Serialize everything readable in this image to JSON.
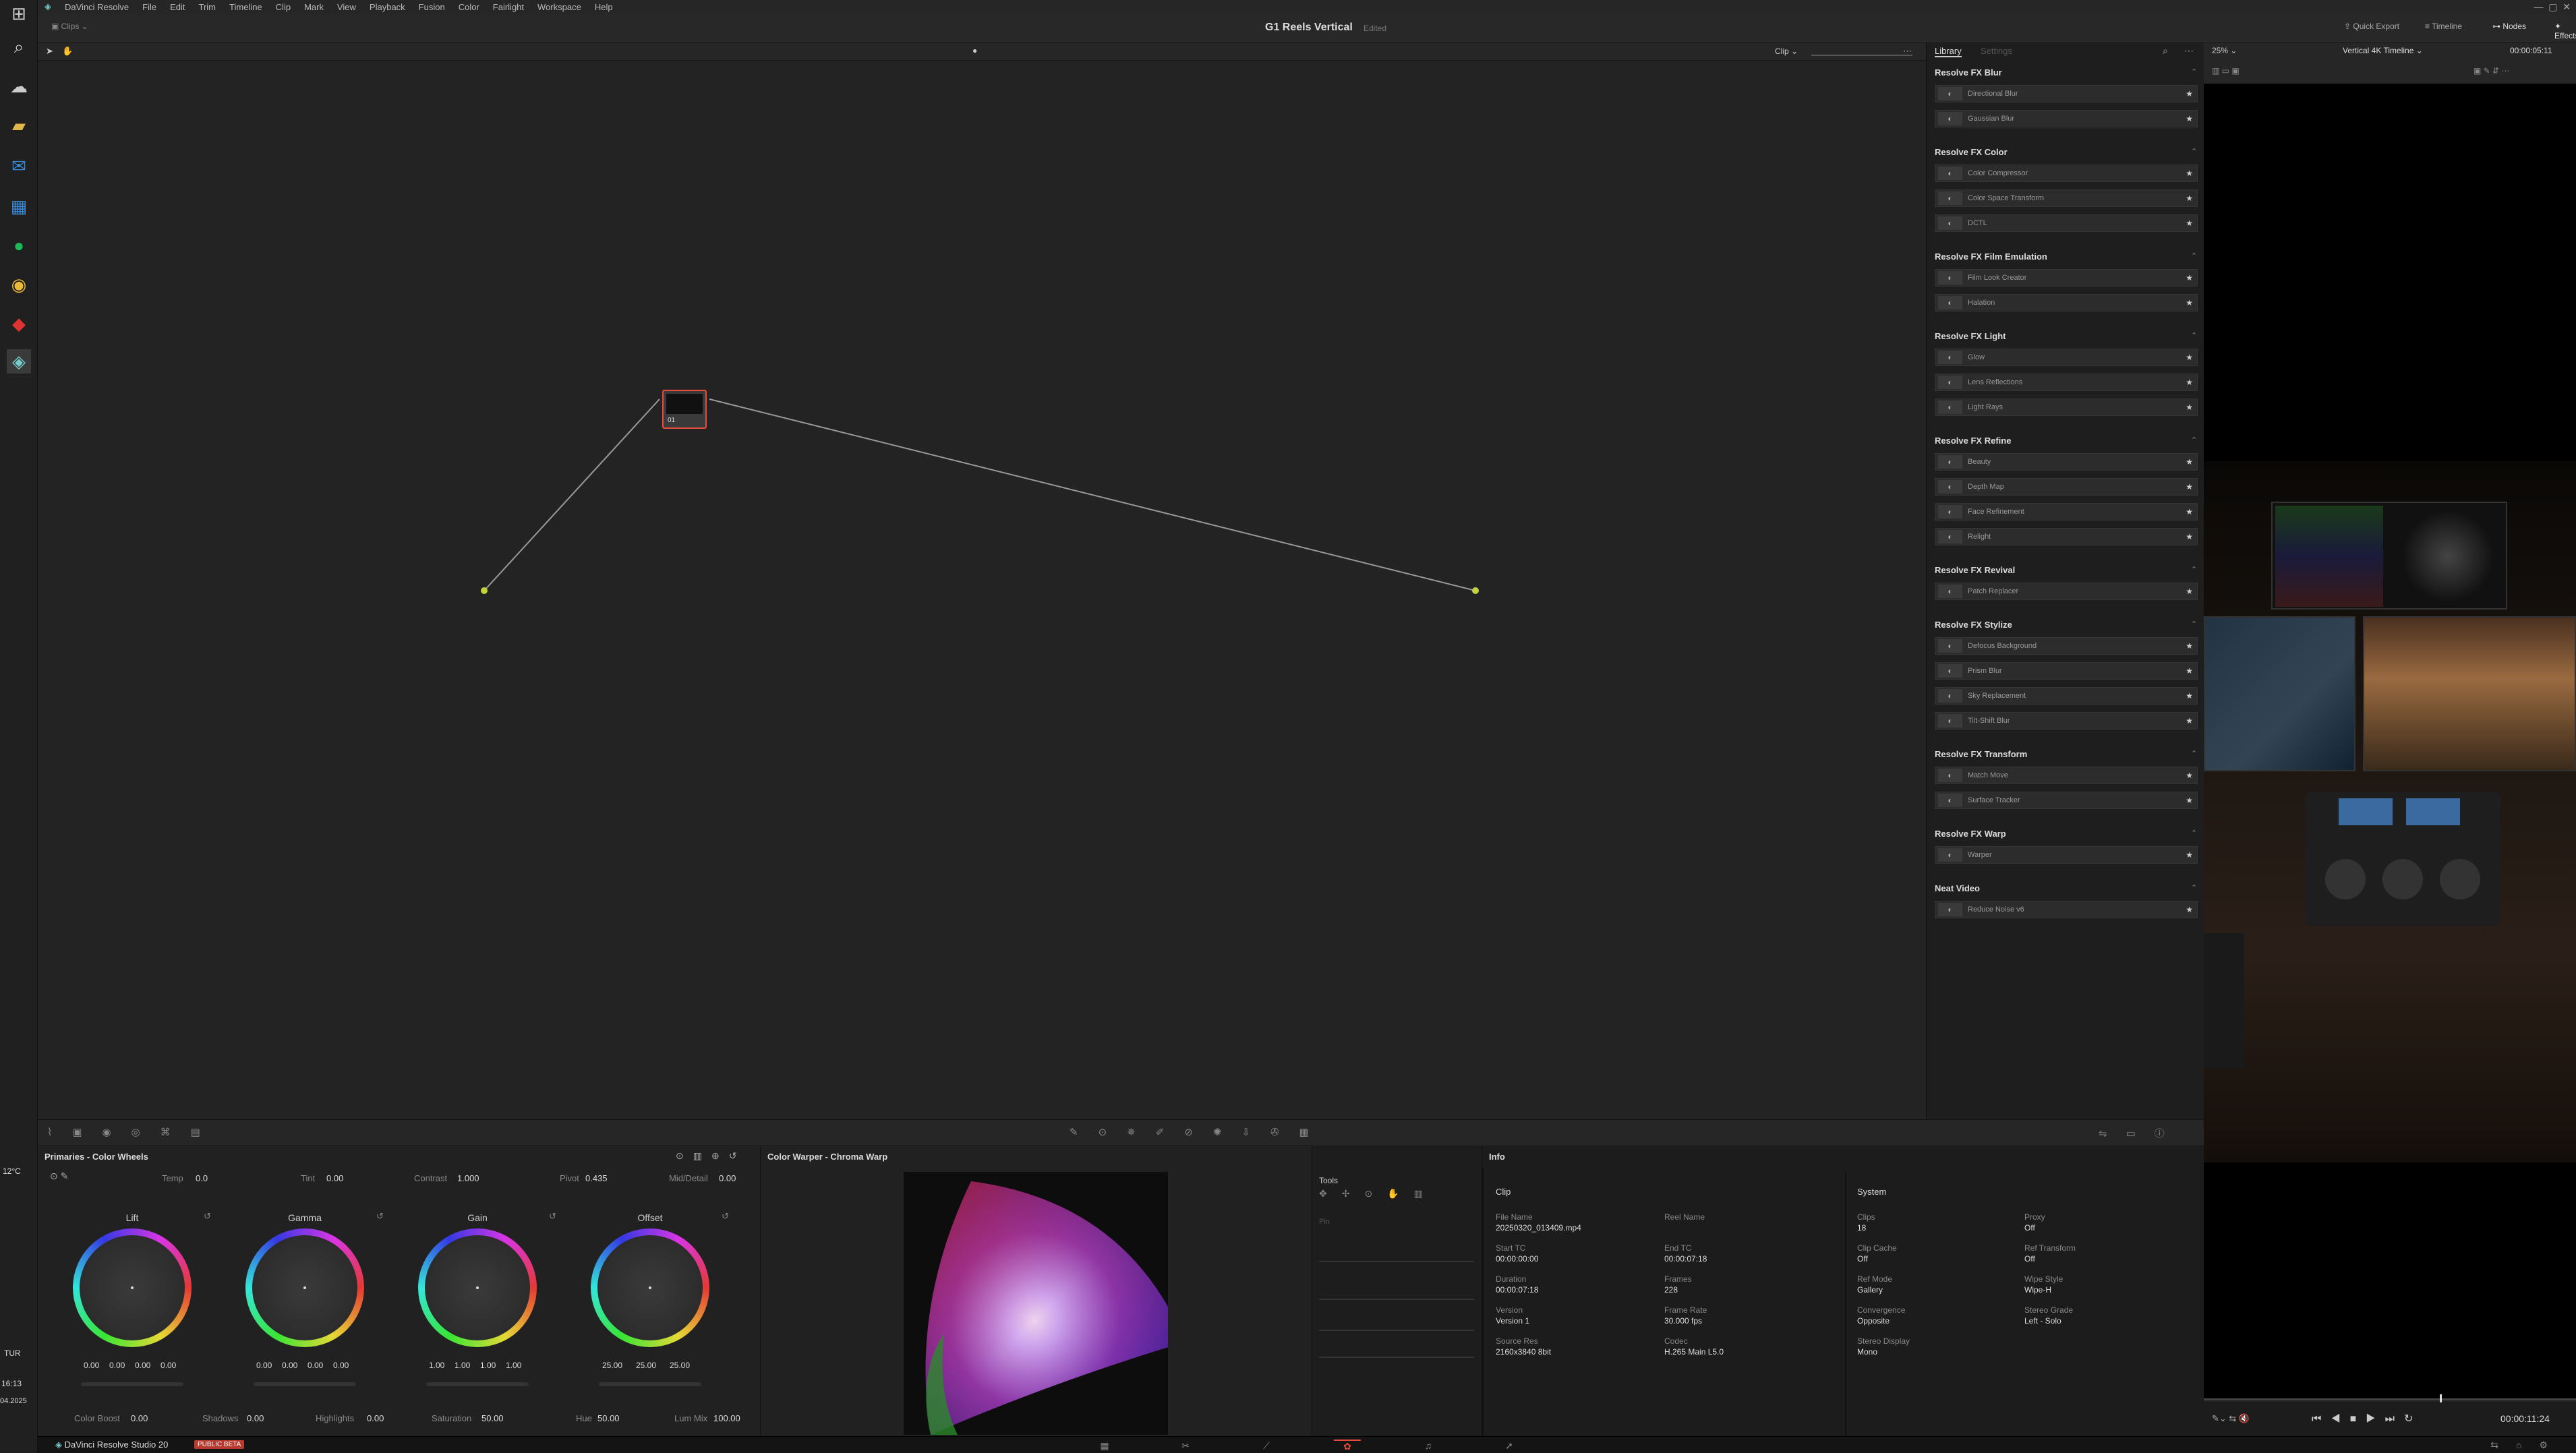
{
  "menu": {
    "app": "DaVinci Resolve",
    "items": [
      "File",
      "Edit",
      "Trim",
      "Timeline",
      "Clip",
      "Mark",
      "View",
      "Playback",
      "Fusion",
      "Color",
      "Fairlight",
      "Workspace",
      "Help"
    ]
  },
  "header": {
    "clips_label": "Clips",
    "project_title": "G1 Reels Vertical",
    "status": "Edited",
    "quick_export": "Quick Export",
    "timeline": "Timeline",
    "nodes": "Nodes",
    "effects": "Effects"
  },
  "node_editor": {
    "mode": "Clip",
    "node_label": "01"
  },
  "library": {
    "tab_library": "Library",
    "tab_settings": "Settings",
    "sections": [
      {
        "title": "Resolve FX Blur",
        "items": [
          "Directional Blur",
          "Gaussian Blur"
        ]
      },
      {
        "title": "Resolve FX Color",
        "items": [
          "Color Compressor",
          "Color Space Transform",
          "DCTL"
        ]
      },
      {
        "title": "Resolve FX Film Emulation",
        "items": [
          "Film Look Creator",
          "Halation"
        ]
      },
      {
        "title": "Resolve FX Light",
        "items": [
          "Glow",
          "Lens Reflections",
          "Light Rays"
        ]
      },
      {
        "title": "Resolve FX Refine",
        "items": [
          "Beauty",
          "Depth Map",
          "Face Refinement",
          "Relight"
        ]
      },
      {
        "title": "Resolve FX Revival",
        "items": [
          "Patch Replacer"
        ]
      },
      {
        "title": "Resolve FX Stylize",
        "items": [
          "Defocus Background",
          "Prism Blur",
          "Sky Replacement",
          "Tilt-Shift Blur"
        ]
      },
      {
        "title": "Resolve FX Transform",
        "items": [
          "Match Move",
          "Surface Tracker"
        ]
      },
      {
        "title": "Resolve FX Warp",
        "items": [
          "Warper"
        ]
      },
      {
        "title": "Neat Video",
        "items": [
          "Reduce Noise v6"
        ]
      }
    ]
  },
  "viewer": {
    "zoom": "25%",
    "timeline_name": "Vertical 4K Timeline",
    "timecode_top": "00:00:05:11",
    "timecode_bottom": "00:00:11:24"
  },
  "primaries": {
    "title": "Primaries - Color Wheels",
    "temp_label": "Temp",
    "temp": "0.0",
    "tint_label": "Tint",
    "tint": "0.00",
    "contrast_label": "Contrast",
    "contrast": "1.000",
    "pivot_label": "Pivot",
    "pivot": "0.435",
    "middetail_label": "Mid/Detail",
    "middetail": "0.00",
    "wheels": [
      {
        "name": "Lift",
        "values": [
          "0.00",
          "0.00",
          "0.00",
          "0.00"
        ]
      },
      {
        "name": "Gamma",
        "values": [
          "0.00",
          "0.00",
          "0.00",
          "0.00"
        ]
      },
      {
        "name": "Gain",
        "values": [
          "1.00",
          "1.00",
          "1.00",
          "1.00"
        ]
      },
      {
        "name": "Offset",
        "values": [
          "25.00",
          "25.00",
          "25.00"
        ]
      }
    ],
    "colorboost_label": "Color Boost",
    "colorboost": "0.00",
    "shadows_label": "Shadows",
    "shadows": "0.00",
    "highlights_label": "Highlights",
    "highlights": "0.00",
    "saturation_label": "Saturation",
    "saturation": "50.00",
    "hue_label": "Hue",
    "hue": "50.00",
    "lummix_label": "Lum Mix",
    "lummix": "100.00"
  },
  "warper": {
    "title": "Color Warper - Chroma Warp"
  },
  "tools": {
    "title": "Tools",
    "pin": "Pin"
  },
  "info": {
    "title": "Info",
    "clip_heading": "Clip",
    "system_heading": "System",
    "clip_fields": [
      {
        "k": "File Name",
        "v": "20250320_013409.mp4"
      },
      {
        "k": "Reel Name",
        "v": ""
      },
      {
        "k": "Start TC",
        "v": "00:00:00:00"
      },
      {
        "k": "End TC",
        "v": "00:00:07:18"
      },
      {
        "k": "Duration",
        "v": "00:00:07:18"
      },
      {
        "k": "Frames",
        "v": "228"
      },
      {
        "k": "Version",
        "v": "Version 1"
      },
      {
        "k": "Frame Rate",
        "v": "30.000 fps"
      },
      {
        "k": "Source Res",
        "v": "2160x3840 8bit"
      },
      {
        "k": "Codec",
        "v": "H.265 Main L5.0"
      }
    ],
    "system_fields": [
      {
        "k": "Clips",
        "v": "18"
      },
      {
        "k": "Proxy",
        "v": "Off"
      },
      {
        "k": "Clip Cache",
        "v": "Off"
      },
      {
        "k": "Ref Transform",
        "v": "Off"
      },
      {
        "k": "Ref Mode",
        "v": "Gallery"
      },
      {
        "k": "Wipe Style",
        "v": "Wipe-H"
      },
      {
        "k": "Convergence",
        "v": "Opposite"
      },
      {
        "k": "Stereo Grade",
        "v": "Left - Solo"
      },
      {
        "k": "Stereo Display",
        "v": "Mono"
      }
    ]
  },
  "bottom": {
    "app_name": "DaVinci Resolve Studio 20",
    "beta_badge": "PUBLIC BETA"
  },
  "taskbar": {
    "temp": "12°C",
    "lang": "TUR",
    "time": "16:13",
    "date": "04.2025"
  },
  "colors": {
    "accent": "#e64b3c",
    "panel": "#212121",
    "node_line": "#9a9a9a"
  }
}
